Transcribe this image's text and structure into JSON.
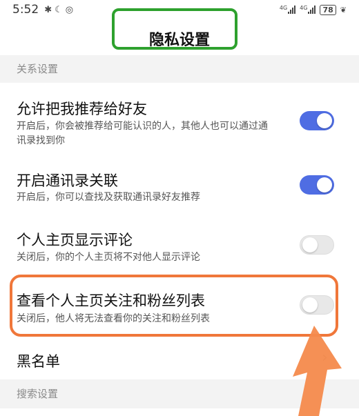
{
  "status_bar": {
    "time": "5:52",
    "icons": [
      "bluetooth-icon",
      "moon-icon",
      "hotspot-icon"
    ],
    "network_tag_1": "4G",
    "network_tag_2": "4G",
    "battery": "78"
  },
  "header": {
    "title": "隐私设置"
  },
  "sections": {
    "relationship": {
      "label": "关系设置"
    },
    "search": {
      "label": "搜索设置"
    }
  },
  "settings": {
    "recommend": {
      "title": "允许把我推荐给好友",
      "desc": "开启后，你会被推荐给可能认识的人，其他人也可以通过通讯录找到你",
      "enabled": true
    },
    "contacts": {
      "title": "开启通讯录关联",
      "desc": "开启后，你可以查找及获取通讯录好友推荐",
      "enabled": true
    },
    "comments": {
      "title": "个人主页显示评论",
      "desc": "关闭后，你的个人主页将不对他人显示评论",
      "enabled": false
    },
    "follow_list": {
      "title": "查看个人主页关注和粉丝列表",
      "desc": "关闭后，他人将无法查看你的关注和粉丝列表",
      "enabled": false
    },
    "blacklist": {
      "title": "黑名单"
    }
  },
  "colors": {
    "toggle_on": "#4f6de3",
    "title_highlight": "#2ea12e",
    "row_highlight": "#f0773a"
  }
}
